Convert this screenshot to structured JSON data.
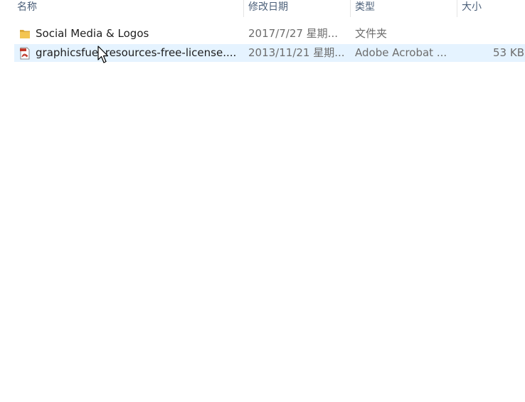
{
  "columns": {
    "name": "名称",
    "date": "修改日期",
    "type": "类型",
    "size": "大小"
  },
  "files": [
    {
      "name": "Social Media & Logos",
      "date": "2017/7/27 星期...",
      "type": "文件夹",
      "size": "",
      "icon": "folder-icon",
      "selected": false
    },
    {
      "name": "graphicsfuel-resources-free-license....",
      "date": "2013/11/21 星期...",
      "type": "Adobe Acrobat ...",
      "size": "53 KB",
      "icon": "pdf-file-icon",
      "selected": true
    }
  ],
  "colors": {
    "header_text": "#4c607a",
    "selection": "#e5f3ff",
    "folder": "#e8b84a",
    "pdf": "#c0392b"
  }
}
